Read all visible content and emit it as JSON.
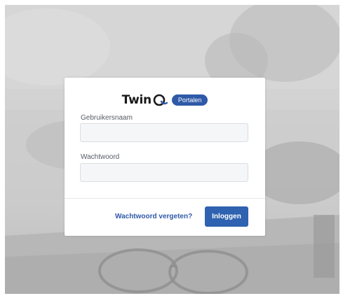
{
  "brand": {
    "name": "Twin",
    "badge": "Portalen"
  },
  "form": {
    "username_label": "Gebruikersnaam",
    "username_value": "",
    "password_label": "Wachtwoord",
    "password_value": "",
    "forgot_link": "Wachtwoord vergeten?",
    "login_button": "Inloggen"
  },
  "colors": {
    "accent": "#2f5aa8",
    "button": "#2f62b0",
    "card": "#ffffff",
    "background_photo": "#cfcfcf"
  },
  "icons": {
    "logo_q": "twinq-q-logo-icon",
    "background": "background-photo-glasses-laptop"
  }
}
